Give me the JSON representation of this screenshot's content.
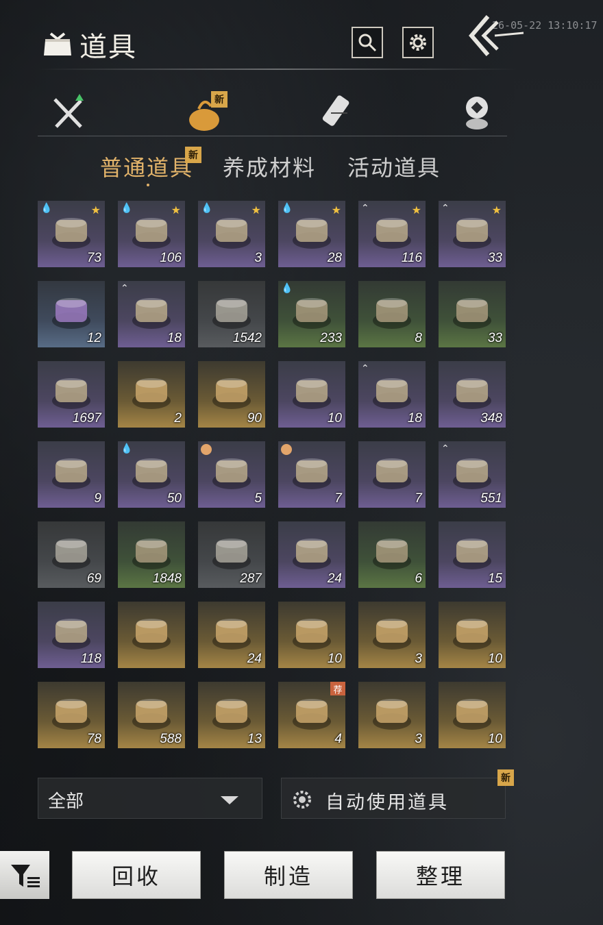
{
  "header": {
    "title": "道具",
    "timestamp": "26-05-22 13:10:17"
  },
  "categories": [
    {
      "name": "equipment",
      "new": false
    },
    {
      "name": "items",
      "new": true,
      "badge": "新"
    },
    {
      "name": "scrolls",
      "new": false
    },
    {
      "name": "currency",
      "new": false
    }
  ],
  "subtabs": [
    {
      "label": "普通道具",
      "active": true,
      "badge": "新"
    },
    {
      "label": "养成材料",
      "active": false
    },
    {
      "label": "活动道具",
      "active": false
    }
  ],
  "items": [
    {
      "count": "73",
      "rarity": "purple",
      "star": true,
      "mark": "drop"
    },
    {
      "count": "106",
      "rarity": "purple",
      "star": true,
      "mark": "drop"
    },
    {
      "count": "3",
      "rarity": "purple",
      "star": true,
      "mark": "drop"
    },
    {
      "count": "28",
      "rarity": "purple",
      "star": true,
      "mark": "drop"
    },
    {
      "count": "116",
      "rarity": "purple",
      "star": true,
      "mark": "tri"
    },
    {
      "count": "33",
      "rarity": "purple",
      "star": true,
      "mark": "tri"
    },
    {
      "count": "12",
      "rarity": "blue",
      "star": false,
      "mark": ""
    },
    {
      "count": "18",
      "rarity": "purple",
      "star": false,
      "mark": "tri"
    },
    {
      "count": "1542",
      "rarity": "gray",
      "star": false,
      "mark": ""
    },
    {
      "count": "233",
      "rarity": "green",
      "star": false,
      "mark": "drop"
    },
    {
      "count": "8",
      "rarity": "green",
      "star": false,
      "mark": ""
    },
    {
      "count": "33",
      "rarity": "green",
      "star": false,
      "mark": ""
    },
    {
      "count": "1697",
      "rarity": "purple",
      "star": false,
      "mark": ""
    },
    {
      "count": "2",
      "rarity": "gold",
      "star": false,
      "mark": ""
    },
    {
      "count": "90",
      "rarity": "gold",
      "star": false,
      "mark": ""
    },
    {
      "count": "10",
      "rarity": "purple",
      "star": false,
      "mark": ""
    },
    {
      "count": "18",
      "rarity": "purple",
      "star": false,
      "mark": "tri"
    },
    {
      "count": "348",
      "rarity": "purple",
      "star": false,
      "mark": ""
    },
    {
      "count": "9",
      "rarity": "purple",
      "star": false,
      "mark": ""
    },
    {
      "count": "50",
      "rarity": "purple",
      "star": false,
      "mark": "drop"
    },
    {
      "count": "5",
      "rarity": "purple",
      "star": false,
      "mark": "clock"
    },
    {
      "count": "7",
      "rarity": "purple",
      "star": false,
      "mark": "clock"
    },
    {
      "count": "7",
      "rarity": "purple",
      "star": false,
      "mark": ""
    },
    {
      "count": "551",
      "rarity": "purple",
      "star": false,
      "mark": "tri"
    },
    {
      "count": "69",
      "rarity": "gray",
      "star": false,
      "mark": ""
    },
    {
      "count": "1848",
      "rarity": "green",
      "star": false,
      "mark": ""
    },
    {
      "count": "287",
      "rarity": "gray",
      "star": false,
      "mark": ""
    },
    {
      "count": "24",
      "rarity": "purple",
      "star": false,
      "mark": ""
    },
    {
      "count": "6",
      "rarity": "green",
      "star": false,
      "mark": ""
    },
    {
      "count": "15",
      "rarity": "purple",
      "star": false,
      "mark": ""
    },
    {
      "count": "118",
      "rarity": "purple",
      "star": false,
      "mark": ""
    },
    {
      "count": "",
      "rarity": "gold",
      "star": false,
      "mark": ""
    },
    {
      "count": "24",
      "rarity": "gold",
      "star": false,
      "mark": ""
    },
    {
      "count": "10",
      "rarity": "gold",
      "star": false,
      "mark": ""
    },
    {
      "count": "3",
      "rarity": "gold",
      "star": false,
      "mark": ""
    },
    {
      "count": "10",
      "rarity": "gold",
      "star": false,
      "mark": ""
    },
    {
      "count": "78",
      "rarity": "gold",
      "star": false,
      "mark": ""
    },
    {
      "count": "588",
      "rarity": "gold",
      "star": false,
      "mark": ""
    },
    {
      "count": "13",
      "rarity": "gold",
      "star": false,
      "mark": ""
    },
    {
      "count": "4",
      "rarity": "gold",
      "star": false,
      "mark": "",
      "recommend": "荐"
    },
    {
      "count": "3",
      "rarity": "gold",
      "star": false,
      "mark": ""
    },
    {
      "count": "10",
      "rarity": "gold",
      "star": false,
      "mark": ""
    }
  ],
  "filter": {
    "selected": "全部"
  },
  "auto_use": {
    "label": "自动使用道具",
    "badge": "新"
  },
  "actions": {
    "recycle": "回收",
    "craft": "制造",
    "sort": "整理"
  }
}
